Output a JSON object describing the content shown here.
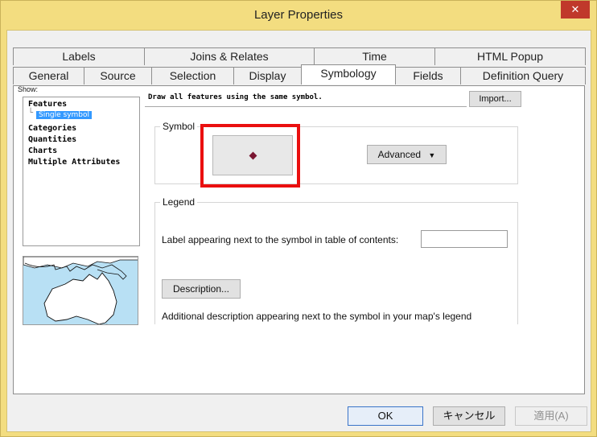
{
  "window": {
    "title": "Layer Properties",
    "close_glyph": "✕"
  },
  "tabs": {
    "row1": [
      "Labels",
      "Joins & Relates",
      "Time",
      "HTML Popup"
    ],
    "row2": [
      "General",
      "Source",
      "Selection",
      "Display",
      "Symbology",
      "Fields",
      "Definition Query"
    ],
    "active": "Symbology"
  },
  "show": {
    "label": "Show:",
    "items": [
      {
        "label": "Features",
        "level": 0
      },
      {
        "label": "Single symbol",
        "level": 1,
        "selected": true
      },
      {
        "label": "Categories",
        "level": 0
      },
      {
        "label": "Quantities",
        "level": 0
      },
      {
        "label": "Charts",
        "level": 0
      },
      {
        "label": "Multiple Attributes",
        "level": 0
      }
    ]
  },
  "symbology": {
    "description": "Draw all features using the same symbol.",
    "import_label": "Import...",
    "symbol_group": "Symbol",
    "advanced_label": "Advanced",
    "symbol_color": "#7a1632",
    "legend_group": "Legend",
    "toc_label": "Label appearing next to the symbol in table of contents:",
    "toc_value": "",
    "description_button": "Description...",
    "additional_description": "Additional description appearing next to the symbol in your map's legend"
  },
  "footer": {
    "ok": "OK",
    "cancel": "キャンセル",
    "apply": "適用(A)"
  },
  "colors": {
    "titlebar": "#f3dd80",
    "highlight": "#ea0f0f",
    "selection": "#3399ff"
  }
}
